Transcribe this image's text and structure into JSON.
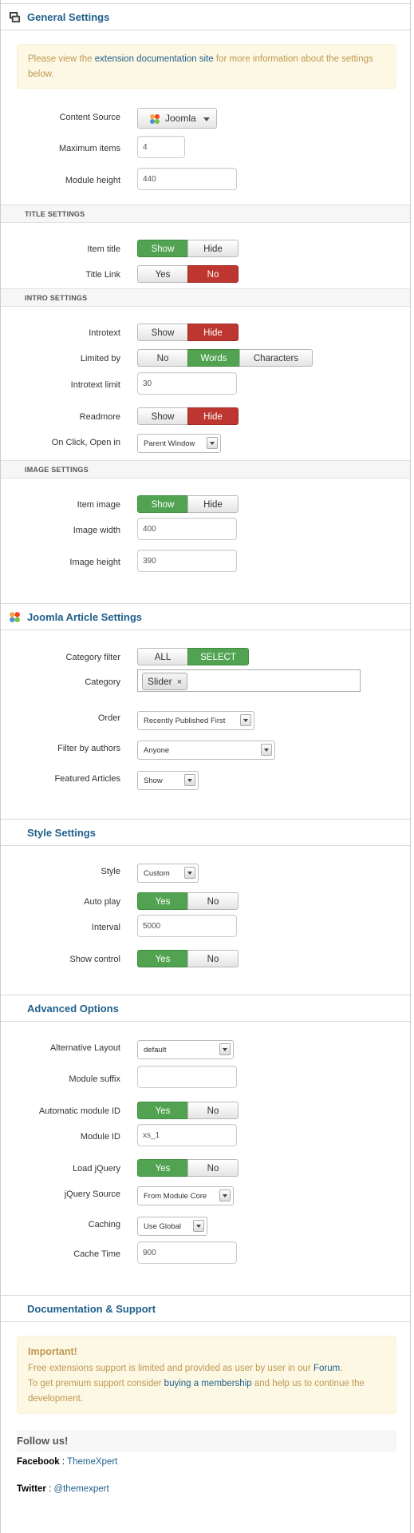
{
  "general": {
    "title": "General Settings",
    "notice_pre": "Please view the ",
    "notice_link": "extension documentation site",
    "notice_post": " for more information about the settings below.",
    "content_source_label": "Content Source",
    "content_source_value": "Joomla",
    "max_items_label": "Maximum items",
    "max_items_value": "4",
    "module_height_label": "Module height",
    "module_height_value": "440"
  },
  "title_settings": {
    "header": "TITLE SETTINGS",
    "item_title_label": "Item title",
    "item_title_show": "Show",
    "item_title_hide": "Hide",
    "title_link_label": "Title Link",
    "title_link_yes": "Yes",
    "title_link_no": "No"
  },
  "intro_settings": {
    "header": "INTRO SETTINGS",
    "introtext_label": "Introtext",
    "introtext_show": "Show",
    "introtext_hide": "Hide",
    "limited_by_label": "Limited by",
    "limited_no": "No",
    "limited_words": "Words",
    "limited_chars": "Characters",
    "intro_limit_label": "Introtext limit",
    "intro_limit_value": "30",
    "readmore_label": "Readmore",
    "readmore_show": "Show",
    "readmore_hide": "Hide",
    "onclick_label": "On Click, Open in",
    "onclick_value": "Parent Window"
  },
  "image_settings": {
    "header": "IMAGE SETTINGS",
    "item_image_label": "Item image",
    "item_image_show": "Show",
    "item_image_hide": "Hide",
    "width_label": "Image width",
    "width_value": "400",
    "height_label": "Image height",
    "height_value": "390"
  },
  "joomla_article": {
    "title": "Joomla Article Settings",
    "category_filter_label": "Category filter",
    "cf_all": "ALL",
    "cf_select": "SELECT",
    "category_label": "Category",
    "category_tag": "Slider",
    "category_tag_remove": "×",
    "order_label": "Order",
    "order_value": "Recently Published First",
    "authors_label": "Filter by authors",
    "authors_value": "Anyone",
    "featured_label": "Featured Articles",
    "featured_value": "Show"
  },
  "style": {
    "title": "Style Settings",
    "style_label": "Style",
    "style_value": "Custom",
    "autoplay_label": "Auto play",
    "autoplay_yes": "Yes",
    "autoplay_no": "No",
    "interval_label": "Interval",
    "interval_value": "5000",
    "show_control_label": "Show control",
    "show_control_yes": "Yes",
    "show_control_no": "No"
  },
  "advanced": {
    "title": "Advanced Options",
    "alt_layout_label": "Alternative Layout",
    "alt_layout_value": "default",
    "suffix_label": "Module suffix",
    "suffix_value": "",
    "auto_id_label": "Automatic module ID",
    "auto_id_yes": "Yes",
    "auto_id_no": "No",
    "module_id_label": "Module ID",
    "module_id_value": "xs_1",
    "jquery_label": "Load jQuery",
    "jquery_yes": "Yes",
    "jquery_no": "No",
    "jquery_source_label": "jQuery Source",
    "jquery_source_value": "From Module Core",
    "caching_label": "Caching",
    "caching_value": "Use Global",
    "cache_time_label": "Cache Time",
    "cache_time_value": "900"
  },
  "docs": {
    "title": "Documentation & Support",
    "important": "Important!",
    "line1_pre": "Free extensions support is limited and provided as user by user in our ",
    "line1_link": "Forum",
    "line1_post": ".",
    "line2_pre": "To get premium support consider ",
    "line2_link": "buying a membership",
    "line2_post": " and help us to continue the development.",
    "follow": "Follow us!",
    "facebook_label": "Facebook",
    "facebook_sep": " : ",
    "facebook_link": "ThemeXpert",
    "twitter_label": "Twitter",
    "twitter_sep": " : ",
    "twitter_link": "@themexpert"
  },
  "colors": {
    "accent": "#1f5f8b",
    "active_green": "#51a351",
    "active_red": "#bd362f",
    "alert_bg": "#fcf8e3",
    "alert_text": "#c09853"
  },
  "icons": {
    "general": "settings-panel-icon",
    "joomla": "joomla-logo-icon"
  }
}
